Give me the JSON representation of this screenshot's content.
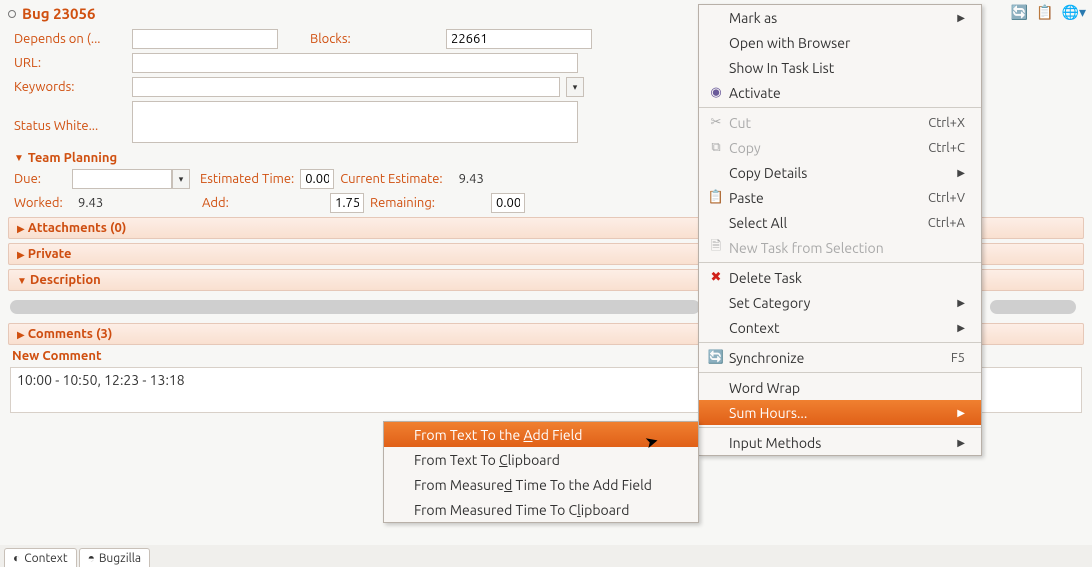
{
  "titlebar": {
    "title": "Bug 23056"
  },
  "form": {
    "depends_on_label": "Depends on (...",
    "depends_on_value": "",
    "blocks_label": "Blocks:",
    "blocks_value": "22661",
    "url_label": "URL:",
    "url_value": "",
    "keywords_label": "Keywords:",
    "keywords_value": "",
    "status_white_label": "Status White...",
    "status_white_value": ""
  },
  "team_planning": {
    "header": "Team Planning",
    "due_label": "Due:",
    "due_value": "",
    "estimated_label": "Estimated Time:",
    "estimated_value": "0.00",
    "current_estimate_label": "Current Estimate:",
    "current_estimate_value": "9.43",
    "worked_label": "Worked:",
    "worked_value": "9.43",
    "add_label": "Add:",
    "add_value": "1.75",
    "remaining_label": "Remaining:",
    "remaining_value": "0.00"
  },
  "sections": {
    "attachments": "Attachments (0)",
    "private": "Private",
    "description": "Description",
    "comments": "Comments (3)"
  },
  "new_comment": {
    "header": "New Comment",
    "text": "10:00 - 10:50, 12:23 - 13:18"
  },
  "tabs": {
    "context": "Context",
    "bugzilla": "Bugzilla"
  },
  "main_menu": {
    "mark_as": "Mark as",
    "open_browser": "Open with Browser",
    "show_task_list": "Show In Task List",
    "activate": "Activate",
    "cut": "Cut",
    "cut_accel": "Ctrl+X",
    "copy": "Copy",
    "copy_accel": "Ctrl+C",
    "copy_details": "Copy Details",
    "paste": "Paste",
    "paste_accel": "Ctrl+V",
    "select_all": "Select All",
    "select_all_accel": "Ctrl+A",
    "new_task_sel": "New Task from Selection",
    "delete_task": "Delete Task",
    "set_category": "Set Category",
    "context": "Context",
    "synchronize": "Synchronize",
    "synchronize_accel": "F5",
    "word_wrap": "Word Wrap",
    "sum_hours": "Sum Hours...",
    "input_methods": "Input Methods"
  },
  "sub_menu": {
    "from_text_add": "From Text To the Add Field",
    "from_text_clip": "From Text To Clipboard",
    "from_measured_add": "From Measured Time To the Add Field",
    "from_measured_clip": "From Measured Time To Clipboard"
  }
}
